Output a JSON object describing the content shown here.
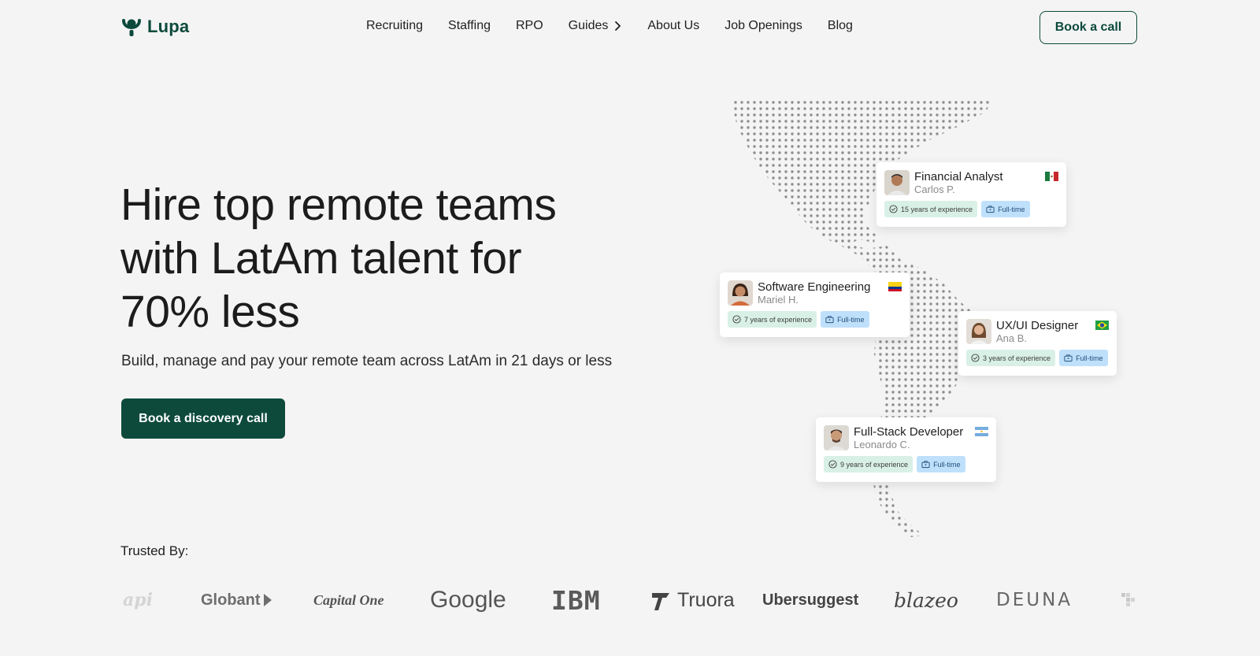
{
  "brand": {
    "name": "Lupa",
    "color": "#0d4a3c"
  },
  "nav": {
    "items": [
      {
        "label": "Recruiting"
      },
      {
        "label": "Staffing"
      },
      {
        "label": "RPO"
      },
      {
        "label": "Guides"
      },
      {
        "label": "About Us"
      },
      {
        "label": "Job Openings"
      },
      {
        "label": "Blog"
      }
    ],
    "cta": "Book a call"
  },
  "hero": {
    "title_lines": [
      "Hire top remote teams",
      "with LatAm talent for",
      "70% less"
    ],
    "subtitle": "Build, manage and pay your remote team across LatAm in 21 days or less",
    "cta": "Book a discovery call"
  },
  "talent_cards": [
    {
      "role": "Financial Analyst",
      "name": "Carlos P.",
      "experience": "15 years of experience",
      "type": "Full-time",
      "flag_icon": "mexico-flag-icon"
    },
    {
      "role": "Software Engineering",
      "name": "Mariel H.",
      "experience": "7 years of experience",
      "type": "Full-time",
      "flag_icon": "colombia-flag-icon"
    },
    {
      "role": "UX/UI Designer",
      "name": "Ana B.",
      "experience": "3 years of experience",
      "type": "Full-time",
      "flag_icon": "brazil-flag-icon"
    },
    {
      "role": "Full-Stack Developer",
      "name": "Leonardo C.",
      "experience": "9 years of experience",
      "type": "Full-time",
      "flag_icon": "argentina-flag-icon"
    }
  ],
  "trusted": {
    "label": "Trusted By:",
    "logos": [
      "api",
      "Globant",
      "Capital One",
      "Google",
      "IBM",
      "Truora",
      "Ubersuggest",
      "blazeo",
      "DEUNA"
    ]
  },
  "colors": {
    "accent": "#0d4a3c",
    "background": "#f4f4f4",
    "tag_experience": "#d9f0e6",
    "tag_fulltime": "#bfe0fb"
  }
}
